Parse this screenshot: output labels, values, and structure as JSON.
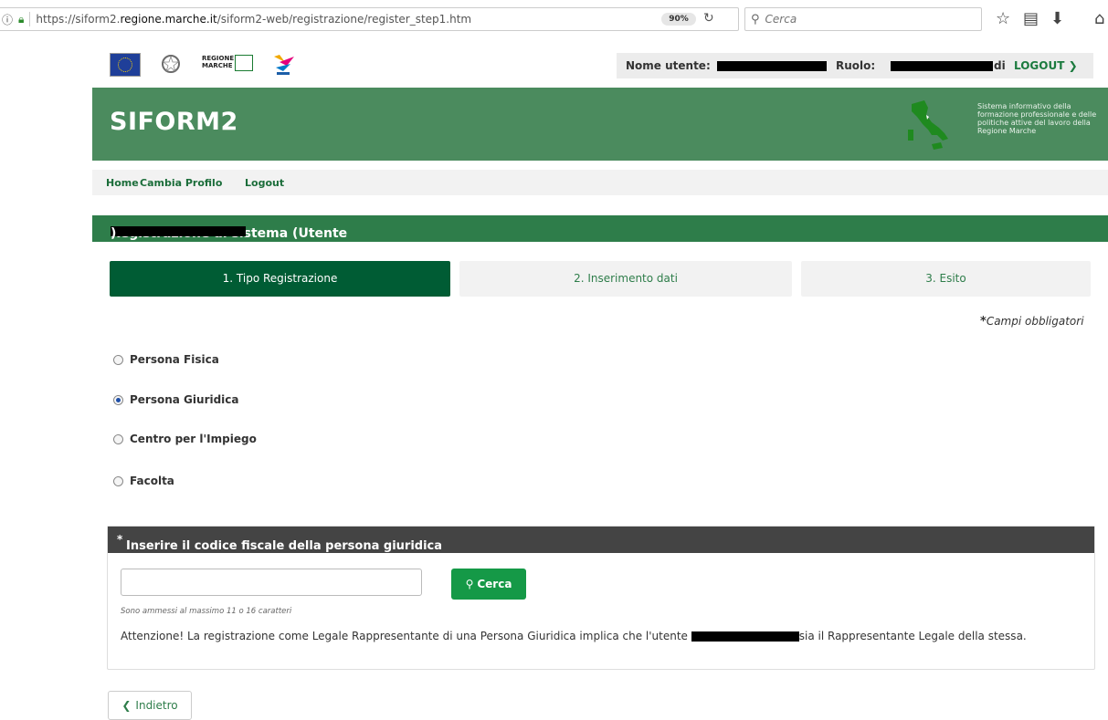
{
  "browser": {
    "url_prefix": "https://siform2.",
    "url_domain": "regione.marche.it",
    "url_path": "/siform2-web/registrazione/register_step1.htm",
    "zoom": "90%",
    "search_placeholder": "Cerca"
  },
  "header": {
    "logo_marche_text": "REGIONE MARCHE",
    "user_label": "Nome utente:",
    "role_label": "Ruolo:",
    "role_suffix": "di",
    "logout_label": "LOGOUT ❯"
  },
  "banner": {
    "title": "SIFORM2",
    "description": "Sistema informativo della formazione professionale e delle politiche attive del lavoro della Regione Marche"
  },
  "nav": {
    "items": [
      "Home",
      "Cambia Profilo",
      "Logout"
    ]
  },
  "section": {
    "title": "Registrazione al sistema (Utente",
    "title_end": ")"
  },
  "steps": [
    "1. Tipo Registrazione",
    "2. Inserimento dati",
    "3. Esito"
  ],
  "required_note": "Campi obbligatori",
  "radios": [
    {
      "label": "Persona Fisica",
      "checked": false
    },
    {
      "label": "Persona Giuridica",
      "checked": true
    },
    {
      "label": "Centro per l'Impiego",
      "checked": false
    },
    {
      "label": "Facolta",
      "checked": false
    }
  ],
  "cf_panel": {
    "title": "Inserire il codice fiscale della persona giuridica",
    "input_value": "",
    "search_button": "Cerca",
    "hint": "Sono ammessi al massimo 11 o 16 caratteri",
    "warning_start": "Attenzione! La registrazione come Legale Rappresentante di una Persona Giuridica implica che l'utente",
    "warning_end": "sia il Rappresentante Legale della stessa."
  },
  "back_button": "Indietro",
  "colors": {
    "brand_green": "#4b8b5e",
    "section_green": "#2e7d4a",
    "active_step": "#005c34",
    "button_green": "#159947",
    "panel_header": "#444444"
  }
}
